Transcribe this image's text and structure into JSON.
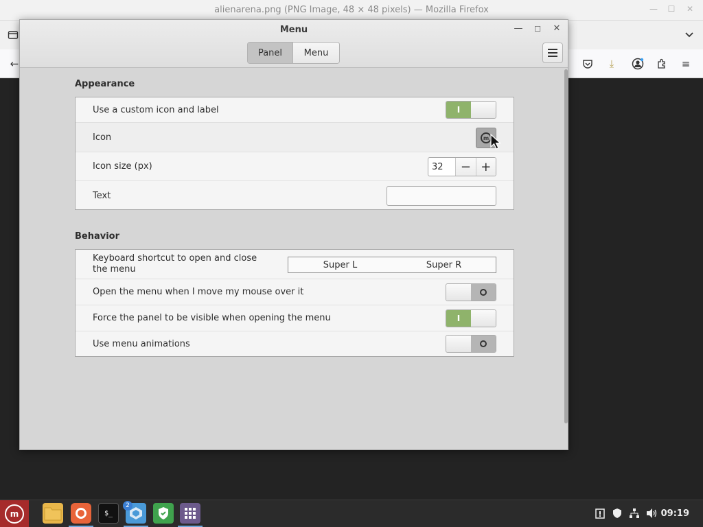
{
  "firefox": {
    "title": "alienarena.png (PNG Image, 48 × 48 pixels) — Mozilla Firefox"
  },
  "dialog": {
    "title": "Menu",
    "tabs": [
      {
        "label": "Panel",
        "active": true
      },
      {
        "label": "Menu",
        "active": false
      }
    ]
  },
  "appearance": {
    "title": "Appearance",
    "custom_icon_label": "Use a custom icon and label",
    "custom_icon_state": "on",
    "icon_label": "Icon",
    "icon_size_label": "Icon size (px)",
    "icon_size_value": "32",
    "text_label": "Text",
    "text_value": ""
  },
  "behavior": {
    "title": "Behavior",
    "shortcut_label": "Keyboard shortcut to open and close the menu",
    "shortcut_1": "Super L",
    "shortcut_2": "Super R",
    "hover_label": "Open the menu when I move my mouse over it",
    "hover_state": "off",
    "panel_visible_label": "Force the panel to be visible when opening the menu",
    "panel_visible_state": "on",
    "animations_label": "Use menu animations",
    "animations_state": "off"
  },
  "switch_glyphs": {
    "on": "I"
  },
  "taskbar": {
    "clock": "09:19",
    "notification_badge": "2"
  },
  "colors": {
    "switch_on": "#8fb36b",
    "menu_button": "#a62b2b"
  }
}
